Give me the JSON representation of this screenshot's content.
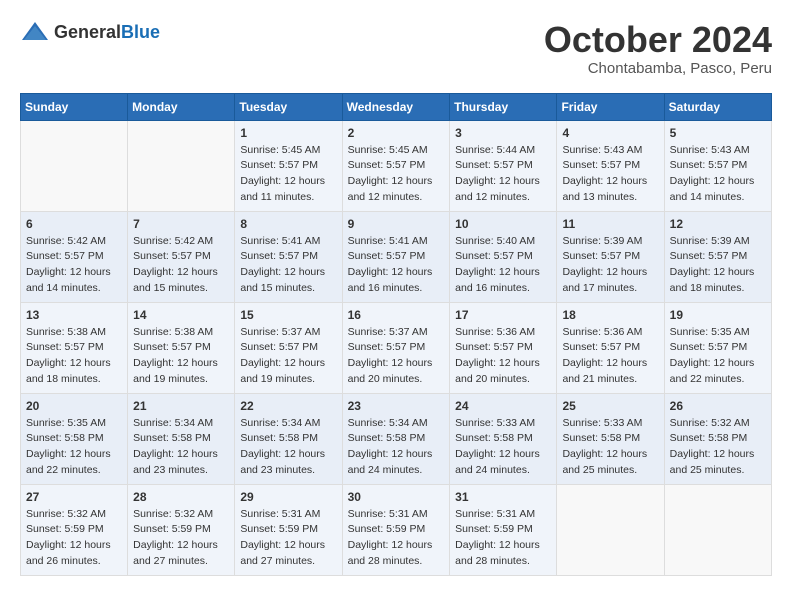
{
  "header": {
    "logo_general": "General",
    "logo_blue": "Blue",
    "title": "October 2024",
    "subtitle": "Chontabamba, Pasco, Peru"
  },
  "days_of_week": [
    "Sunday",
    "Monday",
    "Tuesday",
    "Wednesday",
    "Thursday",
    "Friday",
    "Saturday"
  ],
  "weeks": [
    [
      {
        "day": "",
        "sunrise": "",
        "sunset": "",
        "daylight": ""
      },
      {
        "day": "",
        "sunrise": "",
        "sunset": "",
        "daylight": ""
      },
      {
        "day": "1",
        "sunrise": "Sunrise: 5:45 AM",
        "sunset": "Sunset: 5:57 PM",
        "daylight": "Daylight: 12 hours and 11 minutes."
      },
      {
        "day": "2",
        "sunrise": "Sunrise: 5:45 AM",
        "sunset": "Sunset: 5:57 PM",
        "daylight": "Daylight: 12 hours and 12 minutes."
      },
      {
        "day": "3",
        "sunrise": "Sunrise: 5:44 AM",
        "sunset": "Sunset: 5:57 PM",
        "daylight": "Daylight: 12 hours and 12 minutes."
      },
      {
        "day": "4",
        "sunrise": "Sunrise: 5:43 AM",
        "sunset": "Sunset: 5:57 PM",
        "daylight": "Daylight: 12 hours and 13 minutes."
      },
      {
        "day": "5",
        "sunrise": "Sunrise: 5:43 AM",
        "sunset": "Sunset: 5:57 PM",
        "daylight": "Daylight: 12 hours and 14 minutes."
      }
    ],
    [
      {
        "day": "6",
        "sunrise": "Sunrise: 5:42 AM",
        "sunset": "Sunset: 5:57 PM",
        "daylight": "Daylight: 12 hours and 14 minutes."
      },
      {
        "day": "7",
        "sunrise": "Sunrise: 5:42 AM",
        "sunset": "Sunset: 5:57 PM",
        "daylight": "Daylight: 12 hours and 15 minutes."
      },
      {
        "day": "8",
        "sunrise": "Sunrise: 5:41 AM",
        "sunset": "Sunset: 5:57 PM",
        "daylight": "Daylight: 12 hours and 15 minutes."
      },
      {
        "day": "9",
        "sunrise": "Sunrise: 5:41 AM",
        "sunset": "Sunset: 5:57 PM",
        "daylight": "Daylight: 12 hours and 16 minutes."
      },
      {
        "day": "10",
        "sunrise": "Sunrise: 5:40 AM",
        "sunset": "Sunset: 5:57 PM",
        "daylight": "Daylight: 12 hours and 16 minutes."
      },
      {
        "day": "11",
        "sunrise": "Sunrise: 5:39 AM",
        "sunset": "Sunset: 5:57 PM",
        "daylight": "Daylight: 12 hours and 17 minutes."
      },
      {
        "day": "12",
        "sunrise": "Sunrise: 5:39 AM",
        "sunset": "Sunset: 5:57 PM",
        "daylight": "Daylight: 12 hours and 18 minutes."
      }
    ],
    [
      {
        "day": "13",
        "sunrise": "Sunrise: 5:38 AM",
        "sunset": "Sunset: 5:57 PM",
        "daylight": "Daylight: 12 hours and 18 minutes."
      },
      {
        "day": "14",
        "sunrise": "Sunrise: 5:38 AM",
        "sunset": "Sunset: 5:57 PM",
        "daylight": "Daylight: 12 hours and 19 minutes."
      },
      {
        "day": "15",
        "sunrise": "Sunrise: 5:37 AM",
        "sunset": "Sunset: 5:57 PM",
        "daylight": "Daylight: 12 hours and 19 minutes."
      },
      {
        "day": "16",
        "sunrise": "Sunrise: 5:37 AM",
        "sunset": "Sunset: 5:57 PM",
        "daylight": "Daylight: 12 hours and 20 minutes."
      },
      {
        "day": "17",
        "sunrise": "Sunrise: 5:36 AM",
        "sunset": "Sunset: 5:57 PM",
        "daylight": "Daylight: 12 hours and 20 minutes."
      },
      {
        "day": "18",
        "sunrise": "Sunrise: 5:36 AM",
        "sunset": "Sunset: 5:57 PM",
        "daylight": "Daylight: 12 hours and 21 minutes."
      },
      {
        "day": "19",
        "sunrise": "Sunrise: 5:35 AM",
        "sunset": "Sunset: 5:57 PM",
        "daylight": "Daylight: 12 hours and 22 minutes."
      }
    ],
    [
      {
        "day": "20",
        "sunrise": "Sunrise: 5:35 AM",
        "sunset": "Sunset: 5:58 PM",
        "daylight": "Daylight: 12 hours and 22 minutes."
      },
      {
        "day": "21",
        "sunrise": "Sunrise: 5:34 AM",
        "sunset": "Sunset: 5:58 PM",
        "daylight": "Daylight: 12 hours and 23 minutes."
      },
      {
        "day": "22",
        "sunrise": "Sunrise: 5:34 AM",
        "sunset": "Sunset: 5:58 PM",
        "daylight": "Daylight: 12 hours and 23 minutes."
      },
      {
        "day": "23",
        "sunrise": "Sunrise: 5:34 AM",
        "sunset": "Sunset: 5:58 PM",
        "daylight": "Daylight: 12 hours and 24 minutes."
      },
      {
        "day": "24",
        "sunrise": "Sunrise: 5:33 AM",
        "sunset": "Sunset: 5:58 PM",
        "daylight": "Daylight: 12 hours and 24 minutes."
      },
      {
        "day": "25",
        "sunrise": "Sunrise: 5:33 AM",
        "sunset": "Sunset: 5:58 PM",
        "daylight": "Daylight: 12 hours and 25 minutes."
      },
      {
        "day": "26",
        "sunrise": "Sunrise: 5:32 AM",
        "sunset": "Sunset: 5:58 PM",
        "daylight": "Daylight: 12 hours and 25 minutes."
      }
    ],
    [
      {
        "day": "27",
        "sunrise": "Sunrise: 5:32 AM",
        "sunset": "Sunset: 5:59 PM",
        "daylight": "Daylight: 12 hours and 26 minutes."
      },
      {
        "day": "28",
        "sunrise": "Sunrise: 5:32 AM",
        "sunset": "Sunset: 5:59 PM",
        "daylight": "Daylight: 12 hours and 27 minutes."
      },
      {
        "day": "29",
        "sunrise": "Sunrise: 5:31 AM",
        "sunset": "Sunset: 5:59 PM",
        "daylight": "Daylight: 12 hours and 27 minutes."
      },
      {
        "day": "30",
        "sunrise": "Sunrise: 5:31 AM",
        "sunset": "Sunset: 5:59 PM",
        "daylight": "Daylight: 12 hours and 28 minutes."
      },
      {
        "day": "31",
        "sunrise": "Sunrise: 5:31 AM",
        "sunset": "Sunset: 5:59 PM",
        "daylight": "Daylight: 12 hours and 28 minutes."
      },
      {
        "day": "",
        "sunrise": "",
        "sunset": "",
        "daylight": ""
      },
      {
        "day": "",
        "sunrise": "",
        "sunset": "",
        "daylight": ""
      }
    ]
  ]
}
